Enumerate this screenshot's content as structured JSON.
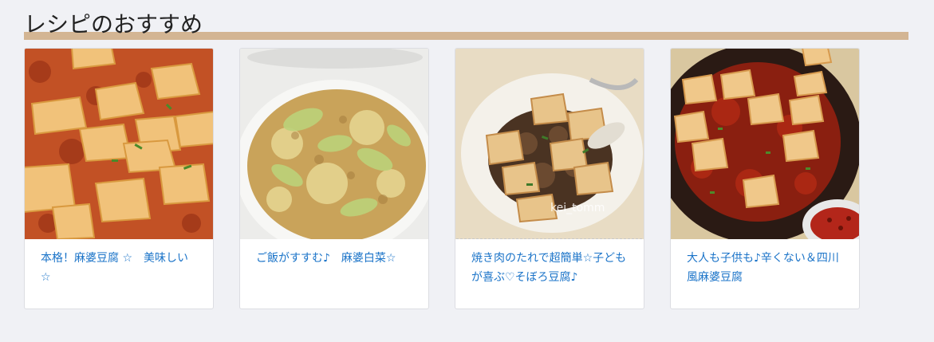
{
  "section": {
    "title": "レシピのおすすめ"
  },
  "colors": {
    "accent_bar": "#d3b593",
    "link": "#1a73c8",
    "background": "#f0f1f5"
  },
  "recipes": [
    {
      "title": "本格！麻婆豆腐 ☆　美味しい　☆",
      "image": "mapo-tofu-photo"
    },
    {
      "title": "ご飯がすすむ♪　麻婆白菜☆",
      "image": "mapo-cabbage-photo"
    },
    {
      "title": "焼き肉のたれで超簡単☆子どもが喜ぶ♡そぼろ豆腐♪",
      "image": "minced-meat-tofu-photo",
      "watermark": "kei_tomm"
    },
    {
      "title": "大人も子供も♪辛くない＆四川風麻婆豆腐",
      "image": "sichuan-mapo-tofu-photo"
    }
  ]
}
